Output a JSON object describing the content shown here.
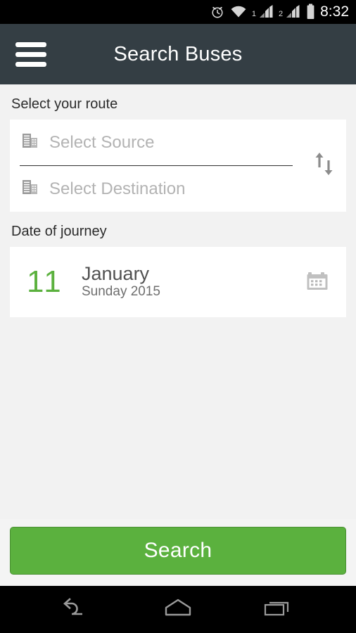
{
  "status_bar": {
    "icons": [
      "alarm-clock-icon",
      "wifi-icon",
      "signal-icon",
      "signal-icon",
      "battery-icon"
    ],
    "sim1_label": "1",
    "sim2_label": "2",
    "time": "8:32"
  },
  "action_bar": {
    "menu_icon": "hamburger-menu-icon",
    "title": "Search Buses"
  },
  "route_section": {
    "label": "Select your route",
    "source_placeholder": "Select Source",
    "source_value": "",
    "destination_placeholder": "Select Destination",
    "destination_value": "",
    "source_icon": "building-icon",
    "destination_icon": "building-icon",
    "swap_icon": "swap-vertical-arrows-icon"
  },
  "date_section": {
    "label": "Date of journey",
    "day": "11",
    "month": "January",
    "weekday_year": "Sunday 2015",
    "calendar_icon": "calendar-icon"
  },
  "footer": {
    "search_label": "Search"
  },
  "nav_bar": {
    "back_icon": "back-arrow-icon",
    "home_icon": "home-icon",
    "recents_icon": "recent-apps-icon"
  },
  "colors": {
    "accent_green": "#5bb13e",
    "action_bar": "#343e44",
    "page_background": "#f2f2f2",
    "placeholder_text": "#b3b3b3",
    "status_bar": "#000000"
  }
}
